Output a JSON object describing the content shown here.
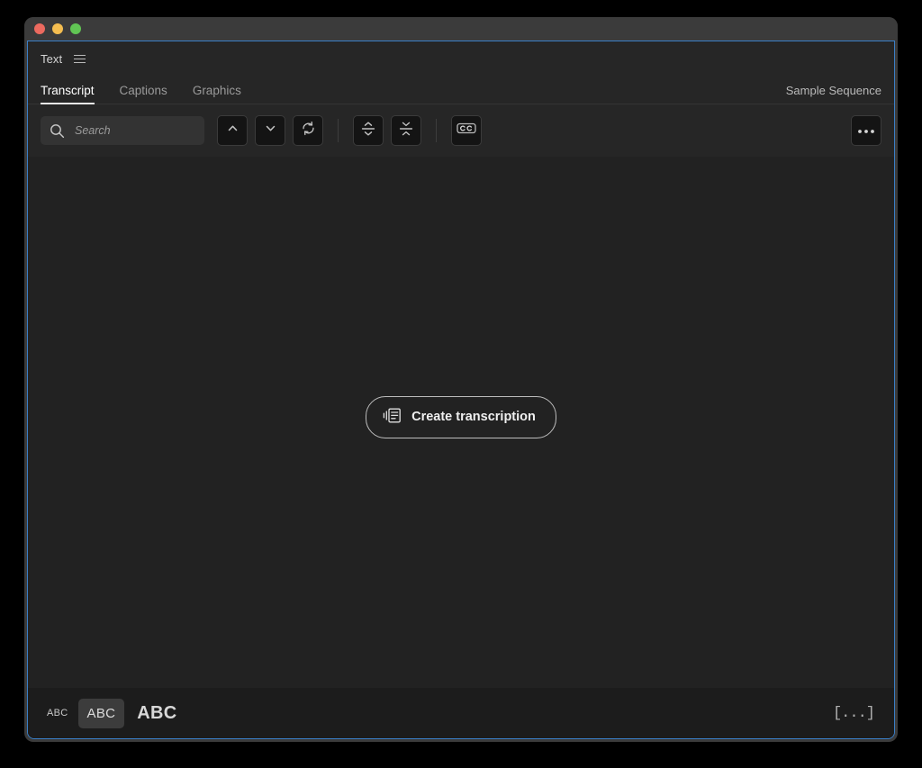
{
  "window": {
    "traffic_lights": [
      {
        "name": "close",
        "color": "#ec6a5f"
      },
      {
        "name": "minimize",
        "color": "#f4bd50"
      },
      {
        "name": "maximize",
        "color": "#61c554"
      }
    ],
    "focus_border_color": "#3a7fc7"
  },
  "panel": {
    "title": "Text",
    "menu_icon": "hamburger-menu-icon"
  },
  "tabs": [
    {
      "label": "Transcript",
      "active": true
    },
    {
      "label": "Captions",
      "active": false
    },
    {
      "label": "Graphics",
      "active": false
    }
  ],
  "sequence": {
    "name": "Sample Sequence"
  },
  "search": {
    "placeholder": "Search",
    "value": "",
    "icon": "search-icon"
  },
  "toolbar": {
    "buttons": [
      {
        "name": "previous-match-button",
        "icon": "chevron-up-icon",
        "title": "Previous"
      },
      {
        "name": "next-match-button",
        "icon": "chevron-down-icon",
        "title": "Next"
      },
      {
        "name": "sync-transcript-button",
        "icon": "refresh-icon",
        "title": "Sync"
      },
      {
        "name": "split-caption-button",
        "icon": "split-caption-icon",
        "title": "Split"
      },
      {
        "name": "merge-caption-button",
        "icon": "merge-caption-icon",
        "title": "Merge"
      },
      {
        "name": "captions-toggle-button",
        "icon": "cc-icon",
        "title": "CC"
      },
      {
        "name": "more-options-button",
        "icon": "ellipsis-icon",
        "title": "More"
      }
    ]
  },
  "empty_state": {
    "button_label": "Create transcription",
    "button_icon": "transcribe-document-icon"
  },
  "bottom_bar": {
    "text_sizes": [
      {
        "label": "ABC",
        "size": "small",
        "selected": false
      },
      {
        "label": "ABC",
        "size": "medium",
        "selected": true
      },
      {
        "label": "ABC",
        "size": "large",
        "selected": false
      }
    ],
    "pause_toggle": {
      "label": "[...]",
      "name": "show-pauses-button"
    }
  },
  "colors": {
    "app_background": "#222222",
    "chrome_background": "#262626",
    "titlebar": "#3b3b3b",
    "accent_focus": "#3a7fc7",
    "text_primary": "#ffffff",
    "text_secondary": "#9a9a9a"
  }
}
